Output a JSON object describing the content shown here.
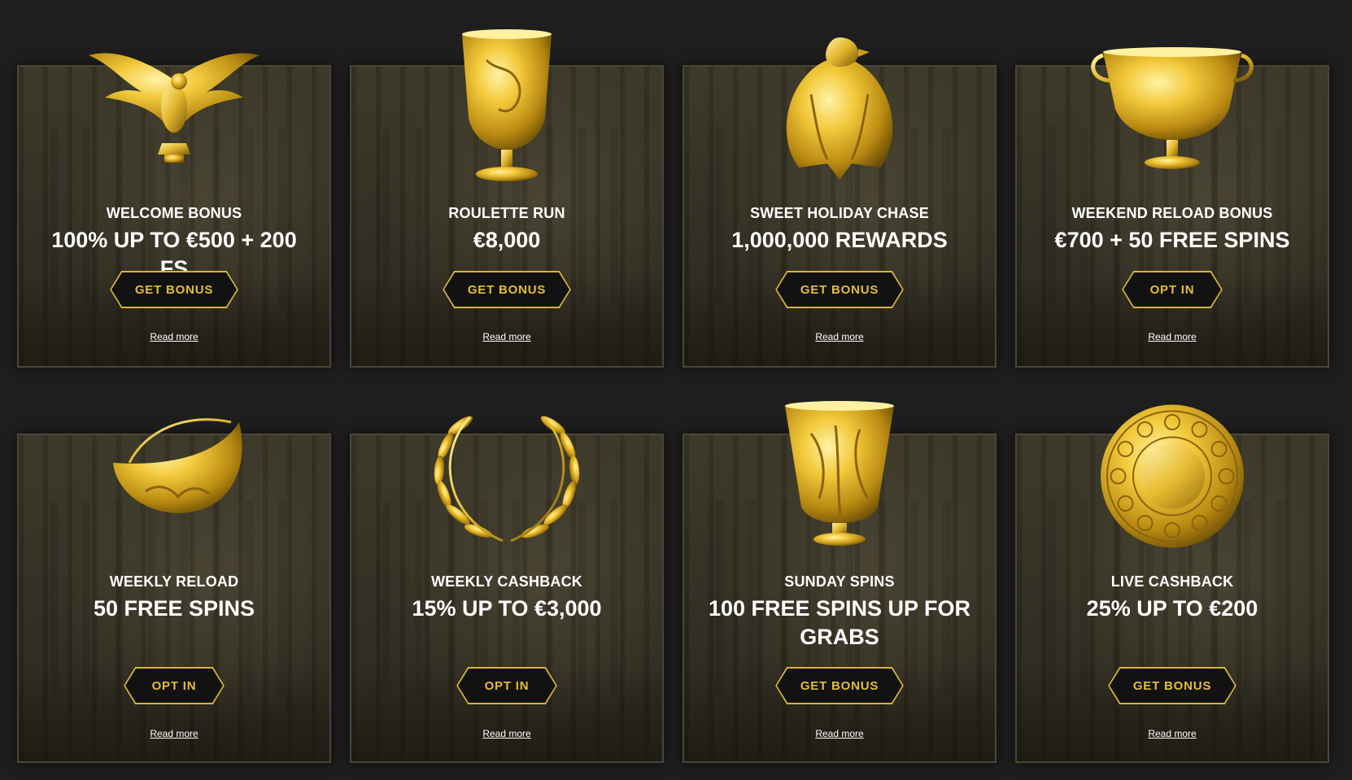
{
  "colors": {
    "accent": "#d9b43a",
    "background": "#1e1e1e",
    "card": "#312d22",
    "text": "#ffffff"
  },
  "promotions": [
    {
      "title": "WELCOME BONUS",
      "prize": "100% UP TO €500 + 200 FS",
      "button": "GET BONUS",
      "read_more": "Read more",
      "icon": "golden-eagle-icon"
    },
    {
      "title": "ROULETTE RUN",
      "prize": "€8,000",
      "button": "GET BONUS",
      "read_more": "Read more",
      "icon": "golden-cup-icon"
    },
    {
      "title": "SWEET HOLIDAY CHASE",
      "prize": "1,000,000 REWARDS",
      "button": "GET BONUS",
      "read_more": "Read more",
      "icon": "golden-eagle-statue-icon"
    },
    {
      "title": "WEEKEND RELOAD BONUS",
      "prize": "€700 + 50 FREE SPINS",
      "button": "OPT IN",
      "read_more": "Read more",
      "icon": "golden-chalice-icon"
    },
    {
      "title": "WEEKLY RELOAD",
      "prize": "50 FREE SPINS",
      "button": "OPT IN",
      "read_more": "Read more",
      "icon": "golden-pouch-icon"
    },
    {
      "title": "WEEKLY CASHBACK",
      "prize": "15% UP TO €3,000",
      "button": "OPT IN",
      "read_more": "Read more",
      "icon": "laurel-wreath-icon"
    },
    {
      "title": "SUNDAY SPINS",
      "prize": "100 FREE SPINS UP FOR GRABS",
      "button": "GET BONUS",
      "read_more": "Read more",
      "icon": "golden-vase-icon"
    },
    {
      "title": "LIVE CASHBACK",
      "prize": "25% UP TO €200",
      "button": "GET BONUS",
      "read_more": "Read more",
      "icon": "golden-coin-plate-icon"
    }
  ]
}
